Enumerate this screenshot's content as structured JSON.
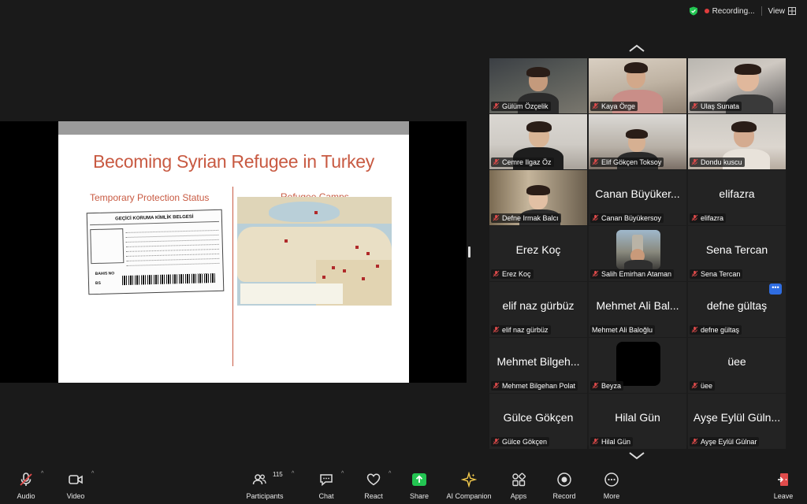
{
  "topbar": {
    "recording_label": "Recording...",
    "view_label": "View"
  },
  "slide": {
    "title": "Becoming Syrian Refugee in Turkey",
    "left_heading": "Temporary Protection Status",
    "right_heading": "Refugee Camps",
    "id_card_header": "GEÇİCİ KORUMA KİMLİK BELGESİ",
    "id_card_serial": "BAHIS NO",
    "id_card_serial2": "BS"
  },
  "gallery": {
    "tiles": [
      {
        "name": "Gülüm Özçelik",
        "video": true
      },
      {
        "name": "Kaya Örge",
        "video": true
      },
      {
        "name": "Ulaş Sunata",
        "video": true,
        "active": true
      },
      {
        "name": "Cemre Ilgaz Öz",
        "video": true
      },
      {
        "name": "Elif Gökçen Toksoy",
        "video": true
      },
      {
        "name": "Dondu kuscu",
        "video": true
      },
      {
        "name": "Defne Irmak Balcı",
        "video": true
      },
      {
        "name": "Canan Büyükersoy",
        "display": "Canan Büyüker...",
        "video": false
      },
      {
        "name": "elifazra",
        "display": "elifazra",
        "video": false
      },
      {
        "name": "Erez Koç",
        "display": "Erez Koç",
        "video": false
      },
      {
        "name": "Salih Emirhan Ataman",
        "video": false,
        "avatar": "photo"
      },
      {
        "name": "Sena Tercan",
        "display": "Sena Tercan",
        "video": false
      },
      {
        "name": "elif naz gürbüz",
        "display": "elif naz gürbüz",
        "video": false
      },
      {
        "name": "Mehmet Ali Baloğlu",
        "display": "Mehmet Ali Bal...",
        "video": false,
        "mic_hidden": true
      },
      {
        "name": "defne gültaş",
        "display": "defne gültaş",
        "video": false
      },
      {
        "name": "Mehmet Bilgehan Polat",
        "display": "Mehmet Bilgeh...",
        "video": false
      },
      {
        "name": "Beyza",
        "video": false,
        "avatar": "black"
      },
      {
        "name": "üee",
        "display": "üee",
        "video": false
      },
      {
        "name": "Gülce Gökçen",
        "display": "Gülce Gökçen",
        "video": false
      },
      {
        "name": "Hilal Gün",
        "display": "Hilal Gün",
        "video": false
      },
      {
        "name": "Ayşe Eylül Gülnar",
        "display": "Ayşe Eylül Güln...",
        "video": false
      }
    ],
    "more_label": "•••"
  },
  "toolbar": {
    "audio": "Audio",
    "video": "Video",
    "participants": "Participants",
    "participants_count": "115",
    "chat": "Chat",
    "react": "React",
    "share": "Share",
    "ai_companion": "AI Companion",
    "apps": "Apps",
    "record": "Record",
    "more": "More",
    "leave": "Leave"
  },
  "colors": {
    "accent_green": "#23c552",
    "recording_red": "#e03d3d",
    "active_speaker": "#4dbb4d",
    "slide_title": "#c85a42",
    "leave_red": "#e04b4b"
  }
}
